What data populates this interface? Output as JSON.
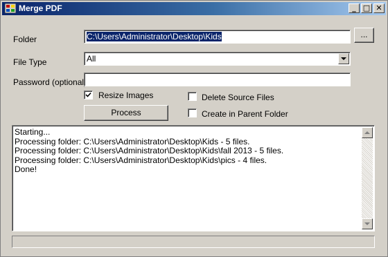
{
  "window": {
    "title": "Merge PDF",
    "minimize_glyph": "_",
    "maximize_glyph": "□",
    "close_glyph": "✕",
    "icon": "merge-pdf-app-icon"
  },
  "form": {
    "folder_label": "Folder",
    "folder_value": "C:\\Users\\Administrator\\Desktop\\Kids",
    "browse_label": "...",
    "file_type_label": "File Type",
    "file_type_value": "All",
    "password_label": "Password (optional)",
    "password_value": "",
    "resize_images_label": "Resize Images",
    "resize_images_checked": true,
    "delete_source_label": "Delete Source Files",
    "delete_source_checked": false,
    "create_parent_label": "Create in Parent Folder",
    "create_parent_checked": false,
    "process_label": "Process"
  },
  "log": {
    "lines": [
      "Starting...",
      "Processing folder: C:\\Users\\Administrator\\Desktop\\Kids - 5 files.",
      "Processing folder: C:\\Users\\Administrator\\Desktop\\Kids\\fall 2013 - 5 files.",
      "Processing folder: C:\\Users\\Administrator\\Desktop\\Kids\\pics - 4 files.",
      "Done!"
    ]
  },
  "progress": {
    "value": 0
  },
  "colors": {
    "title_active": "#0a246a",
    "face": "#d4d0c8",
    "selection": "#0a246a"
  }
}
